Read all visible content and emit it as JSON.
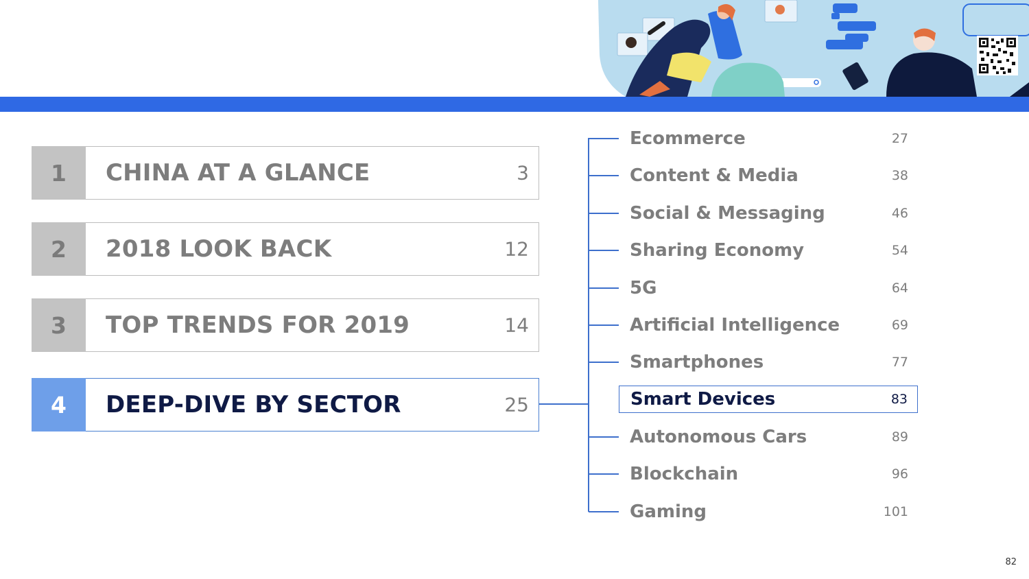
{
  "sections": [
    {
      "number": "1",
      "title": "CHINA AT A GLANCE",
      "page": "3"
    },
    {
      "number": "2",
      "title": "2018 LOOK BACK",
      "page": "12"
    },
    {
      "number": "3",
      "title": "TOP TRENDS FOR 2019",
      "page": "14"
    },
    {
      "number": "4",
      "title": "DEEP-DIVE BY SECTOR",
      "page": "25"
    }
  ],
  "sectors": [
    {
      "label": "Ecommerce",
      "page": "27"
    },
    {
      "label": "Content & Media",
      "page": "38"
    },
    {
      "label": "Social & Messaging",
      "page": "46"
    },
    {
      "label": "Sharing Economy",
      "page": "54"
    },
    {
      "label": "5G",
      "page": "64"
    },
    {
      "label": "Artificial Intelligence",
      "page": "69"
    },
    {
      "label": "Smartphones",
      "page": "77"
    },
    {
      "label": "Smart Devices",
      "page": "83"
    },
    {
      "label": "Autonomous Cars",
      "page": "89"
    },
    {
      "label": "Blockchain",
      "page": "96"
    },
    {
      "label": "Gaming",
      "page": "101"
    }
  ],
  "active_section": "4",
  "active_sector": "Smart Devices",
  "page_number": "82",
  "colors": {
    "accent": "#2f69e4",
    "active_box": "#6e9fe9",
    "inactive_box": "#c3c3c3",
    "active_text": "#0f1a45"
  },
  "hero_icons": [
    "illustration-people-icon",
    "qr-code-icon"
  ]
}
